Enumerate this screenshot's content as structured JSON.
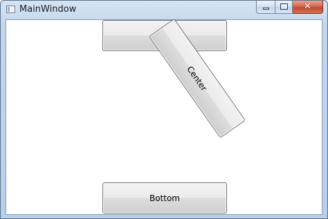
{
  "window": {
    "title": "MainWindow",
    "icon": "window-app-icon",
    "controls": {
      "minimize": "minimize-icon",
      "maximize": "maximize-icon",
      "close_label": "✕"
    }
  },
  "buttons": {
    "top_label": "",
    "center_label": "Center",
    "bottom_label": "Bottom"
  }
}
